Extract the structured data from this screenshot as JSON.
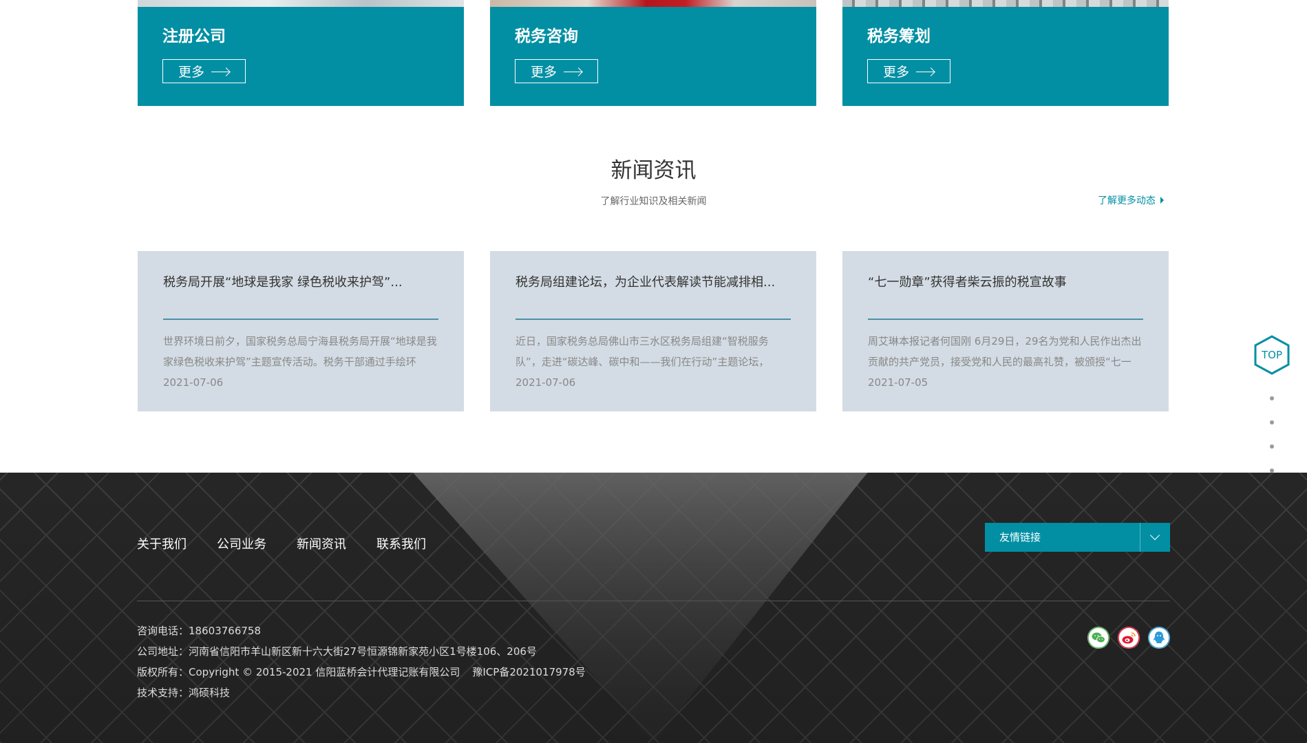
{
  "services": [
    {
      "title": "注册公司",
      "more_label": "更多"
    },
    {
      "title": "税务咨询",
      "more_label": "更多"
    },
    {
      "title": "税务筹划",
      "more_label": "更多"
    }
  ],
  "news": {
    "heading": "新闻资讯",
    "subheading": "了解行业知识及相关新闻",
    "more_link": "了解更多动态",
    "items": [
      {
        "title": "税务局开展“地球是我家 绿色税收来护驾”...",
        "excerpt": "世界环境日前夕，国家税务总局宁海县税务局开展“地球是我家绿色税收来护驾”主题宣传活动。税务干部通过手绘环",
        "date": "2021-07-06"
      },
      {
        "title": "税务局组建论坛，为企业代表解读节能减排相...",
        "excerpt": "近日，国家税务总局佛山市三水区税务局组建“智税服务队”，走进“碳达峰、碳中和——我们在行动”主题论坛，",
        "date": "2021-07-06"
      },
      {
        "title": "“七一勋章”获得者柴云振的税宣故事",
        "excerpt": "周艾琳本报记者何国刚 6月29日，29名为党和人民作出杰出贡献的共产党员，接受党和人民的最高礼赞，被颁授“七一",
        "date": "2021-07-05"
      }
    ]
  },
  "top_button": {
    "label": "TOP"
  },
  "footer": {
    "nav": [
      "关于我们",
      "公司业务",
      "新闻资讯",
      "联系我们"
    ],
    "friend_links_label": "友情链接",
    "phone_label": "咨询电话：",
    "phone": "18603766758",
    "address_label": "公司地址：",
    "address": "河南省信阳市羊山新区新十六大街27号恒源锦新家苑小区1号楼106、206号",
    "copyright_label": "版权所有：",
    "copyright": "Copyright © 2015-2021 信阳蓝桥会计代理记账有限公司",
    "icp": "豫ICP备2021017978号",
    "support_label": "技术支持：",
    "support": "鸿硕科技",
    "social_icons": [
      "wechat-icon",
      "weibo-icon",
      "qq-icon"
    ]
  },
  "colors": {
    "accent": "#028fa4",
    "news_card_bg": "#d3dce4",
    "news_divider": "#4d8ea6",
    "wechat": "#4caf50",
    "weibo": "#e6162d",
    "qq": "#2c9bd8"
  }
}
